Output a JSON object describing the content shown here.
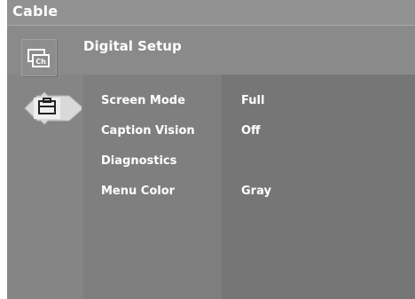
{
  "topbar": {
    "title": "Cable"
  },
  "header": {
    "title": "Digital Setup"
  },
  "icons": {
    "channel": "channel-ch-icon",
    "setup": "toolbox-icon"
  },
  "menu": {
    "items": [
      {
        "label": "Screen Mode",
        "value": "Full"
      },
      {
        "label": "Caption Vision",
        "value": "Off"
      },
      {
        "label": "Diagnostics",
        "value": ""
      },
      {
        "label": "Menu Color",
        "value": "Gray"
      }
    ]
  },
  "colors": {
    "background": "#898989",
    "menu_col": "#7f7f7f",
    "value_col": "#767676",
    "text": "#ffffff"
  }
}
